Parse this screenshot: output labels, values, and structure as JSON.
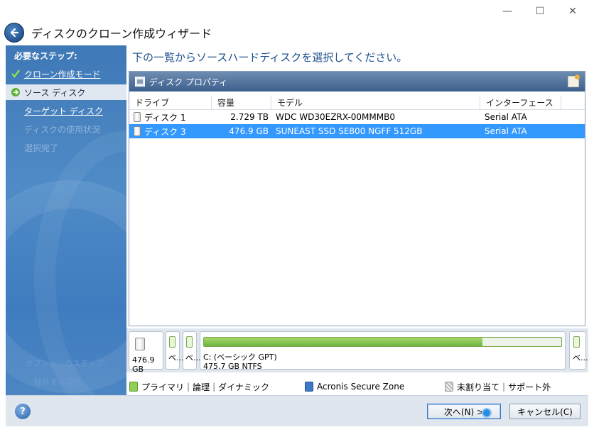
{
  "window": {
    "title": "ディスクのクローン作成ウィザード",
    "minimize_glyph": "—",
    "maximize_glyph": "☐",
    "close_glyph": "✕"
  },
  "sidebar": {
    "heading": "必要なステップ:",
    "steps": [
      {
        "label": "クローン作成モード",
        "state": "done"
      },
      {
        "label": "ソース ディスク",
        "state": "current"
      },
      {
        "label": "ターゲット ディスク",
        "state": "link"
      },
      {
        "label": "ディスクの使用状況",
        "state": "disabled"
      },
      {
        "label": "選択完了",
        "state": "disabled"
      }
    ],
    "optional_heading": "オプションのステップ:",
    "optional_item": "除外する項目"
  },
  "main": {
    "instruction": "下の一覧からソースハードディスクを選択してください。",
    "panel_title": "ディスク プロパティ",
    "columns": [
      "ドライブ",
      "容量",
      "モデル",
      "インターフェース"
    ],
    "rows": [
      {
        "drive": "ディスク 1",
        "capacity": "2.729 TB",
        "model": "WDC WD30EZRX-00MMMB0",
        "interface": "Serial ATA",
        "selected": false
      },
      {
        "drive": "ディスク 3",
        "capacity": "476.9 GB",
        "model": "SUNEAST SSD SE800 NGFF 512GB",
        "interface": "Serial ATA",
        "selected": true
      }
    ]
  },
  "diskmap": {
    "disk_size": "476.9 GB",
    "mini_label": "ベ...",
    "partition_label": "C: (ベーシック GPT)",
    "partition_detail": "475.7 GB  NTFS",
    "partition_used_fraction": 0.78,
    "trailing_label": "ベ..."
  },
  "legend": {
    "primary": "プライマリ",
    "logical": "論理",
    "dynamic": "ダイナミック",
    "secure_zone": "Acronis Secure Zone",
    "unallocated": "未割り当て",
    "unsupported": "サポート外"
  },
  "footer": {
    "help": "?",
    "next": "次へ(N) >",
    "cancel": "キャンセル(C)"
  },
  "colors": {
    "accent": "#3399ff",
    "sidebar": "#4f8bc7",
    "partition_green": "#6cb33e"
  }
}
